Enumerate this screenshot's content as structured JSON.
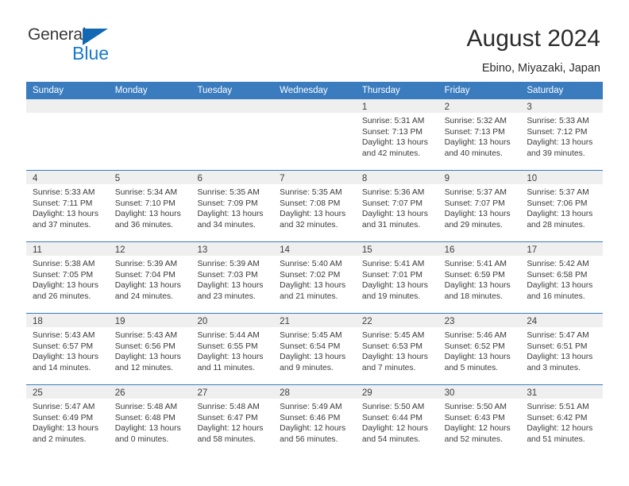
{
  "brand": {
    "name_part1": "General",
    "name_part2": "Blue",
    "logo_icon": "triangle-icon",
    "accent_color": "#1479d1",
    "header_color": "#3a7cbe"
  },
  "header": {
    "title": "August 2024",
    "location": "Ebino, Miyazaki, Japan"
  },
  "calendar": {
    "day_names": [
      "Sunday",
      "Monday",
      "Tuesday",
      "Wednesday",
      "Thursday",
      "Friday",
      "Saturday"
    ],
    "weeks": [
      [
        {
          "day": "",
          "lines": []
        },
        {
          "day": "",
          "lines": []
        },
        {
          "day": "",
          "lines": []
        },
        {
          "day": "",
          "lines": []
        },
        {
          "day": "1",
          "lines": [
            "Sunrise: 5:31 AM",
            "Sunset: 7:13 PM",
            "Daylight: 13 hours",
            "and 42 minutes."
          ]
        },
        {
          "day": "2",
          "lines": [
            "Sunrise: 5:32 AM",
            "Sunset: 7:13 PM",
            "Daylight: 13 hours",
            "and 40 minutes."
          ]
        },
        {
          "day": "3",
          "lines": [
            "Sunrise: 5:33 AM",
            "Sunset: 7:12 PM",
            "Daylight: 13 hours",
            "and 39 minutes."
          ]
        }
      ],
      [
        {
          "day": "4",
          "lines": [
            "Sunrise: 5:33 AM",
            "Sunset: 7:11 PM",
            "Daylight: 13 hours",
            "and 37 minutes."
          ]
        },
        {
          "day": "5",
          "lines": [
            "Sunrise: 5:34 AM",
            "Sunset: 7:10 PM",
            "Daylight: 13 hours",
            "and 36 minutes."
          ]
        },
        {
          "day": "6",
          "lines": [
            "Sunrise: 5:35 AM",
            "Sunset: 7:09 PM",
            "Daylight: 13 hours",
            "and 34 minutes."
          ]
        },
        {
          "day": "7",
          "lines": [
            "Sunrise: 5:35 AM",
            "Sunset: 7:08 PM",
            "Daylight: 13 hours",
            "and 32 minutes."
          ]
        },
        {
          "day": "8",
          "lines": [
            "Sunrise: 5:36 AM",
            "Sunset: 7:07 PM",
            "Daylight: 13 hours",
            "and 31 minutes."
          ]
        },
        {
          "day": "9",
          "lines": [
            "Sunrise: 5:37 AM",
            "Sunset: 7:07 PM",
            "Daylight: 13 hours",
            "and 29 minutes."
          ]
        },
        {
          "day": "10",
          "lines": [
            "Sunrise: 5:37 AM",
            "Sunset: 7:06 PM",
            "Daylight: 13 hours",
            "and 28 minutes."
          ]
        }
      ],
      [
        {
          "day": "11",
          "lines": [
            "Sunrise: 5:38 AM",
            "Sunset: 7:05 PM",
            "Daylight: 13 hours",
            "and 26 minutes."
          ]
        },
        {
          "day": "12",
          "lines": [
            "Sunrise: 5:39 AM",
            "Sunset: 7:04 PM",
            "Daylight: 13 hours",
            "and 24 minutes."
          ]
        },
        {
          "day": "13",
          "lines": [
            "Sunrise: 5:39 AM",
            "Sunset: 7:03 PM",
            "Daylight: 13 hours",
            "and 23 minutes."
          ]
        },
        {
          "day": "14",
          "lines": [
            "Sunrise: 5:40 AM",
            "Sunset: 7:02 PM",
            "Daylight: 13 hours",
            "and 21 minutes."
          ]
        },
        {
          "day": "15",
          "lines": [
            "Sunrise: 5:41 AM",
            "Sunset: 7:01 PM",
            "Daylight: 13 hours",
            "and 19 minutes."
          ]
        },
        {
          "day": "16",
          "lines": [
            "Sunrise: 5:41 AM",
            "Sunset: 6:59 PM",
            "Daylight: 13 hours",
            "and 18 minutes."
          ]
        },
        {
          "day": "17",
          "lines": [
            "Sunrise: 5:42 AM",
            "Sunset: 6:58 PM",
            "Daylight: 13 hours",
            "and 16 minutes."
          ]
        }
      ],
      [
        {
          "day": "18",
          "lines": [
            "Sunrise: 5:43 AM",
            "Sunset: 6:57 PM",
            "Daylight: 13 hours",
            "and 14 minutes."
          ]
        },
        {
          "day": "19",
          "lines": [
            "Sunrise: 5:43 AM",
            "Sunset: 6:56 PM",
            "Daylight: 13 hours",
            "and 12 minutes."
          ]
        },
        {
          "day": "20",
          "lines": [
            "Sunrise: 5:44 AM",
            "Sunset: 6:55 PM",
            "Daylight: 13 hours",
            "and 11 minutes."
          ]
        },
        {
          "day": "21",
          "lines": [
            "Sunrise: 5:45 AM",
            "Sunset: 6:54 PM",
            "Daylight: 13 hours",
            "and 9 minutes."
          ]
        },
        {
          "day": "22",
          "lines": [
            "Sunrise: 5:45 AM",
            "Sunset: 6:53 PM",
            "Daylight: 13 hours",
            "and 7 minutes."
          ]
        },
        {
          "day": "23",
          "lines": [
            "Sunrise: 5:46 AM",
            "Sunset: 6:52 PM",
            "Daylight: 13 hours",
            "and 5 minutes."
          ]
        },
        {
          "day": "24",
          "lines": [
            "Sunrise: 5:47 AM",
            "Sunset: 6:51 PM",
            "Daylight: 13 hours",
            "and 3 minutes."
          ]
        }
      ],
      [
        {
          "day": "25",
          "lines": [
            "Sunrise: 5:47 AM",
            "Sunset: 6:49 PM",
            "Daylight: 13 hours",
            "and 2 minutes."
          ]
        },
        {
          "day": "26",
          "lines": [
            "Sunrise: 5:48 AM",
            "Sunset: 6:48 PM",
            "Daylight: 13 hours",
            "and 0 minutes."
          ]
        },
        {
          "day": "27",
          "lines": [
            "Sunrise: 5:48 AM",
            "Sunset: 6:47 PM",
            "Daylight: 12 hours",
            "and 58 minutes."
          ]
        },
        {
          "day": "28",
          "lines": [
            "Sunrise: 5:49 AM",
            "Sunset: 6:46 PM",
            "Daylight: 12 hours",
            "and 56 minutes."
          ]
        },
        {
          "day": "29",
          "lines": [
            "Sunrise: 5:50 AM",
            "Sunset: 6:44 PM",
            "Daylight: 12 hours",
            "and 54 minutes."
          ]
        },
        {
          "day": "30",
          "lines": [
            "Sunrise: 5:50 AM",
            "Sunset: 6:43 PM",
            "Daylight: 12 hours",
            "and 52 minutes."
          ]
        },
        {
          "day": "31",
          "lines": [
            "Sunrise: 5:51 AM",
            "Sunset: 6:42 PM",
            "Daylight: 12 hours",
            "and 51 minutes."
          ]
        }
      ]
    ]
  }
}
